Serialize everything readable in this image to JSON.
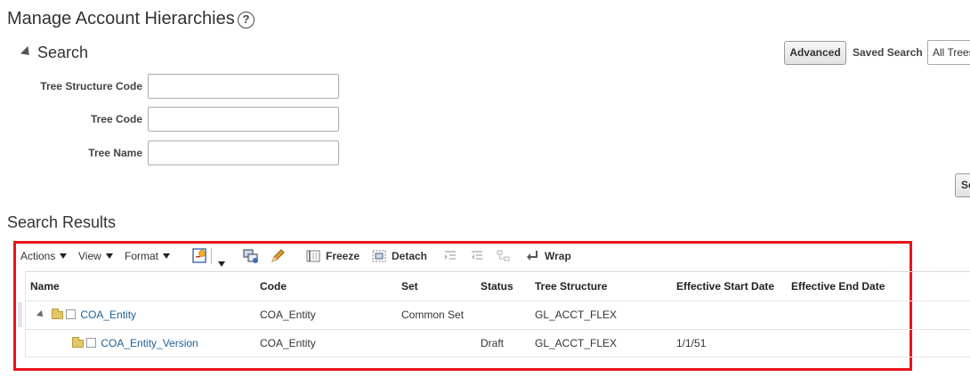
{
  "page": {
    "title": "Manage Account Hierarchies",
    "help_icon": "?"
  },
  "search": {
    "header": "Search",
    "advanced_label": "Advanced",
    "saved_search_label": "Saved Search",
    "saved_search_value": "All Trees",
    "search_button_label": "Search",
    "fields": [
      {
        "label": "Tree Structure Code",
        "value": ""
      },
      {
        "label": "Tree Code",
        "value": ""
      },
      {
        "label": "Tree Name",
        "value": ""
      }
    ]
  },
  "results": {
    "title": "Search Results",
    "toolbar": {
      "actions": "Actions",
      "view": "View",
      "format": "Format",
      "freeze": "Freeze",
      "detach": "Detach",
      "wrap": "Wrap"
    },
    "columns": [
      "Name",
      "Code",
      "Set",
      "Status",
      "Tree Structure",
      "Effective Start Date",
      "Effective End Date"
    ],
    "rows": [
      {
        "name": "COA_Entity",
        "code": "COA_Entity",
        "set": "Common Set",
        "status": "",
        "tree_structure": "GL_ACCT_FLEX",
        "start": "",
        "end": ""
      },
      {
        "name": "COA_Entity_Version",
        "code": "COA_Entity",
        "set": "",
        "status": "Draft",
        "tree_structure": "GL_ACCT_FLEX",
        "start": "1/1/51",
        "end": ""
      }
    ]
  },
  "colors": {
    "highlight_frame": "#e8141b",
    "link": "#1f5e91"
  }
}
